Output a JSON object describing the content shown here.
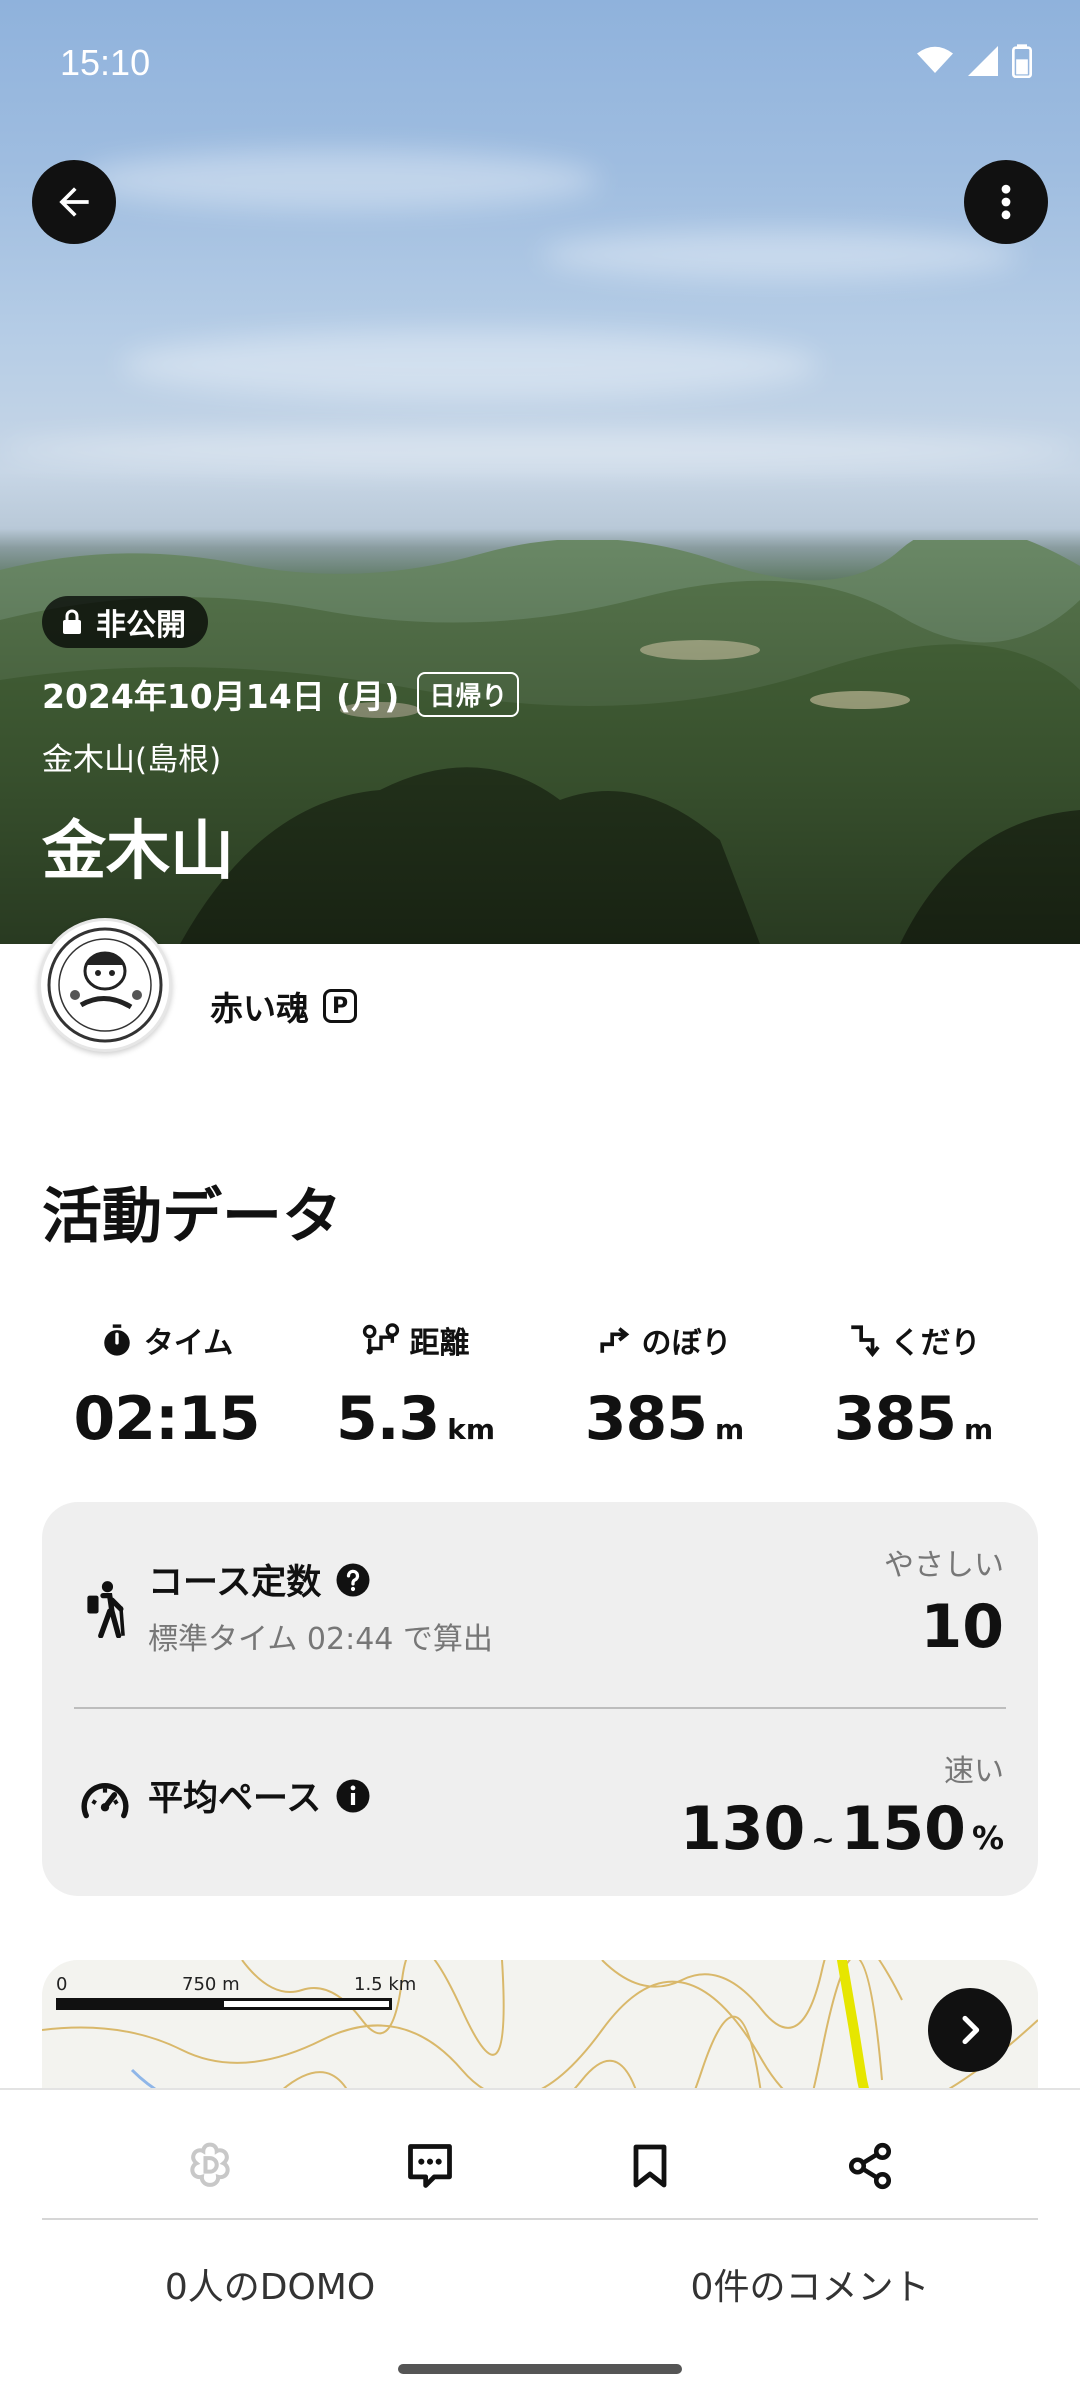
{
  "status_bar": {
    "time": "15:10"
  },
  "hero": {
    "privacy_badge": "非公開",
    "date": "2024年10月14日 (月)",
    "trip_type": "日帰り",
    "mountain": "金木山(島根)",
    "title": "金木山"
  },
  "user": {
    "name": "赤い魂",
    "premium_badge": "P"
  },
  "activity": {
    "section_title": "活動データ",
    "stats": [
      {
        "label": "タイム",
        "value": "02:15",
        "unit": "",
        "icon": "stopwatch-icon"
      },
      {
        "label": "距離",
        "value": "5.3",
        "unit": "km",
        "icon": "route-icon"
      },
      {
        "label": "のぼり",
        "value": "385",
        "unit": "m",
        "icon": "ascent-icon"
      },
      {
        "label": "くだり",
        "value": "385",
        "unit": "m",
        "icon": "descent-icon"
      }
    ],
    "course": {
      "title": "コース定数",
      "subtitle": "標準タイム 02:44 で算出",
      "level": "やさしい",
      "value": "10"
    },
    "pace": {
      "title": "平均ペース",
      "level": "速い",
      "min": "130",
      "sep": "~",
      "max": "150",
      "unit": "%"
    }
  },
  "map": {
    "scale": {
      "zero": "0",
      "mid": "750 m",
      "max": "1.5 km"
    }
  },
  "bottom": {
    "domo_count": "0人のDOMO",
    "comment_count": "0件のコメント"
  },
  "colors": {
    "dark": "#111111",
    "card": "#efefef",
    "muted": "#777777",
    "route": "#e6e600"
  }
}
